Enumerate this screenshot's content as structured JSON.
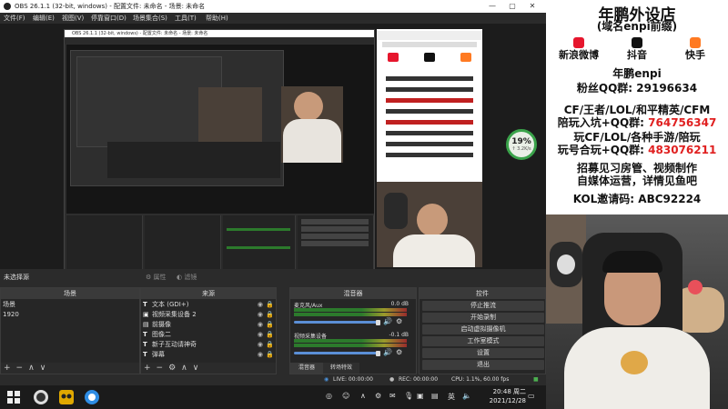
{
  "window": {
    "title": "OBS 26.1.1 (32-bit, windows) - 配置文件: 未命名 - 场景: 未命名",
    "controls": [
      "—",
      "▢",
      "✕"
    ]
  },
  "menu": [
    "文件(F)",
    "编辑(E)",
    "视图(V)",
    "停靠窗口(D)",
    "场景集合(S)",
    "工具(T)",
    "帮助(H)"
  ],
  "nested": {
    "title": "OBS 26.1.1 (32-bit, windows) - 配置文件: 未命名 - 场景: 未命名"
  },
  "info_panel": {
    "title": "年鹏外设店",
    "subtitle": "(域名enpi前缀)",
    "socials": [
      {
        "icon": "weibo-icon",
        "label": "新浪微博",
        "color": "#e6162d"
      },
      {
        "icon": "douyin-icon",
        "label": "抖音",
        "color": "#111111"
      },
      {
        "icon": "kuaishou-icon",
        "label": "快手",
        "color": "#ff7a22"
      }
    ],
    "handle": "年鹏enpi",
    "fan_group": "粉丝QQ群: 29196634",
    "line1": "CF/王者/LOL/和平精英/CFM",
    "line2_prefix": "陪玩入坑+QQ群: ",
    "line2_num": "764756347",
    "line3": "玩CF/LOL/各种手游/陪玩",
    "line4_prefix": "玩号合玩+QQ群: ",
    "line4_num": "483076211",
    "line5": "招募见习房管、视频制作",
    "line6": "自媒体运营，详情见鱼吧",
    "line7": "KOL邀请码: ABC92224",
    "accent_red": "#e02020"
  },
  "gauge": {
    "percent": "19%",
    "speed": "↑ 3.2K/s",
    "value": 0.19
  },
  "scene_bar": {
    "label": "未选择源",
    "properties": "属性",
    "filters": "滤镜"
  },
  "scenes": {
    "header": "场景",
    "items": [
      "场景",
      "1920"
    ]
  },
  "sources": {
    "header": "来源",
    "items": [
      {
        "label": "文本 (GDI+)"
      },
      {
        "label": "视频采集设备 2"
      },
      {
        "label": "前摄像"
      },
      {
        "label": "图像二"
      },
      {
        "label": "新子互动请神奇"
      },
      {
        "label": "弹幕"
      }
    ]
  },
  "mixer": {
    "header": "混音器",
    "channels": [
      {
        "name": "麦克风/Aux",
        "value": "0.0 dB"
      },
      {
        "name": "视频采集设备",
        "value": "-0.1 dB"
      }
    ],
    "tabs": [
      "混音器",
      "转场特效"
    ]
  },
  "controls": {
    "header": "控件",
    "buttons": [
      "停止推流",
      "开始录制",
      "启动虚拟摄像机",
      "工作室模式",
      "设置",
      "退出"
    ]
  },
  "status": {
    "live": "LIVE: 00:00:00",
    "rec": "REC: 00:00:00",
    "cpu": "CPU: 1.1%, 60.00 fps"
  },
  "taskbar": {
    "time": "20:48 周二",
    "date": "2021/12/28",
    "lang": "英"
  }
}
